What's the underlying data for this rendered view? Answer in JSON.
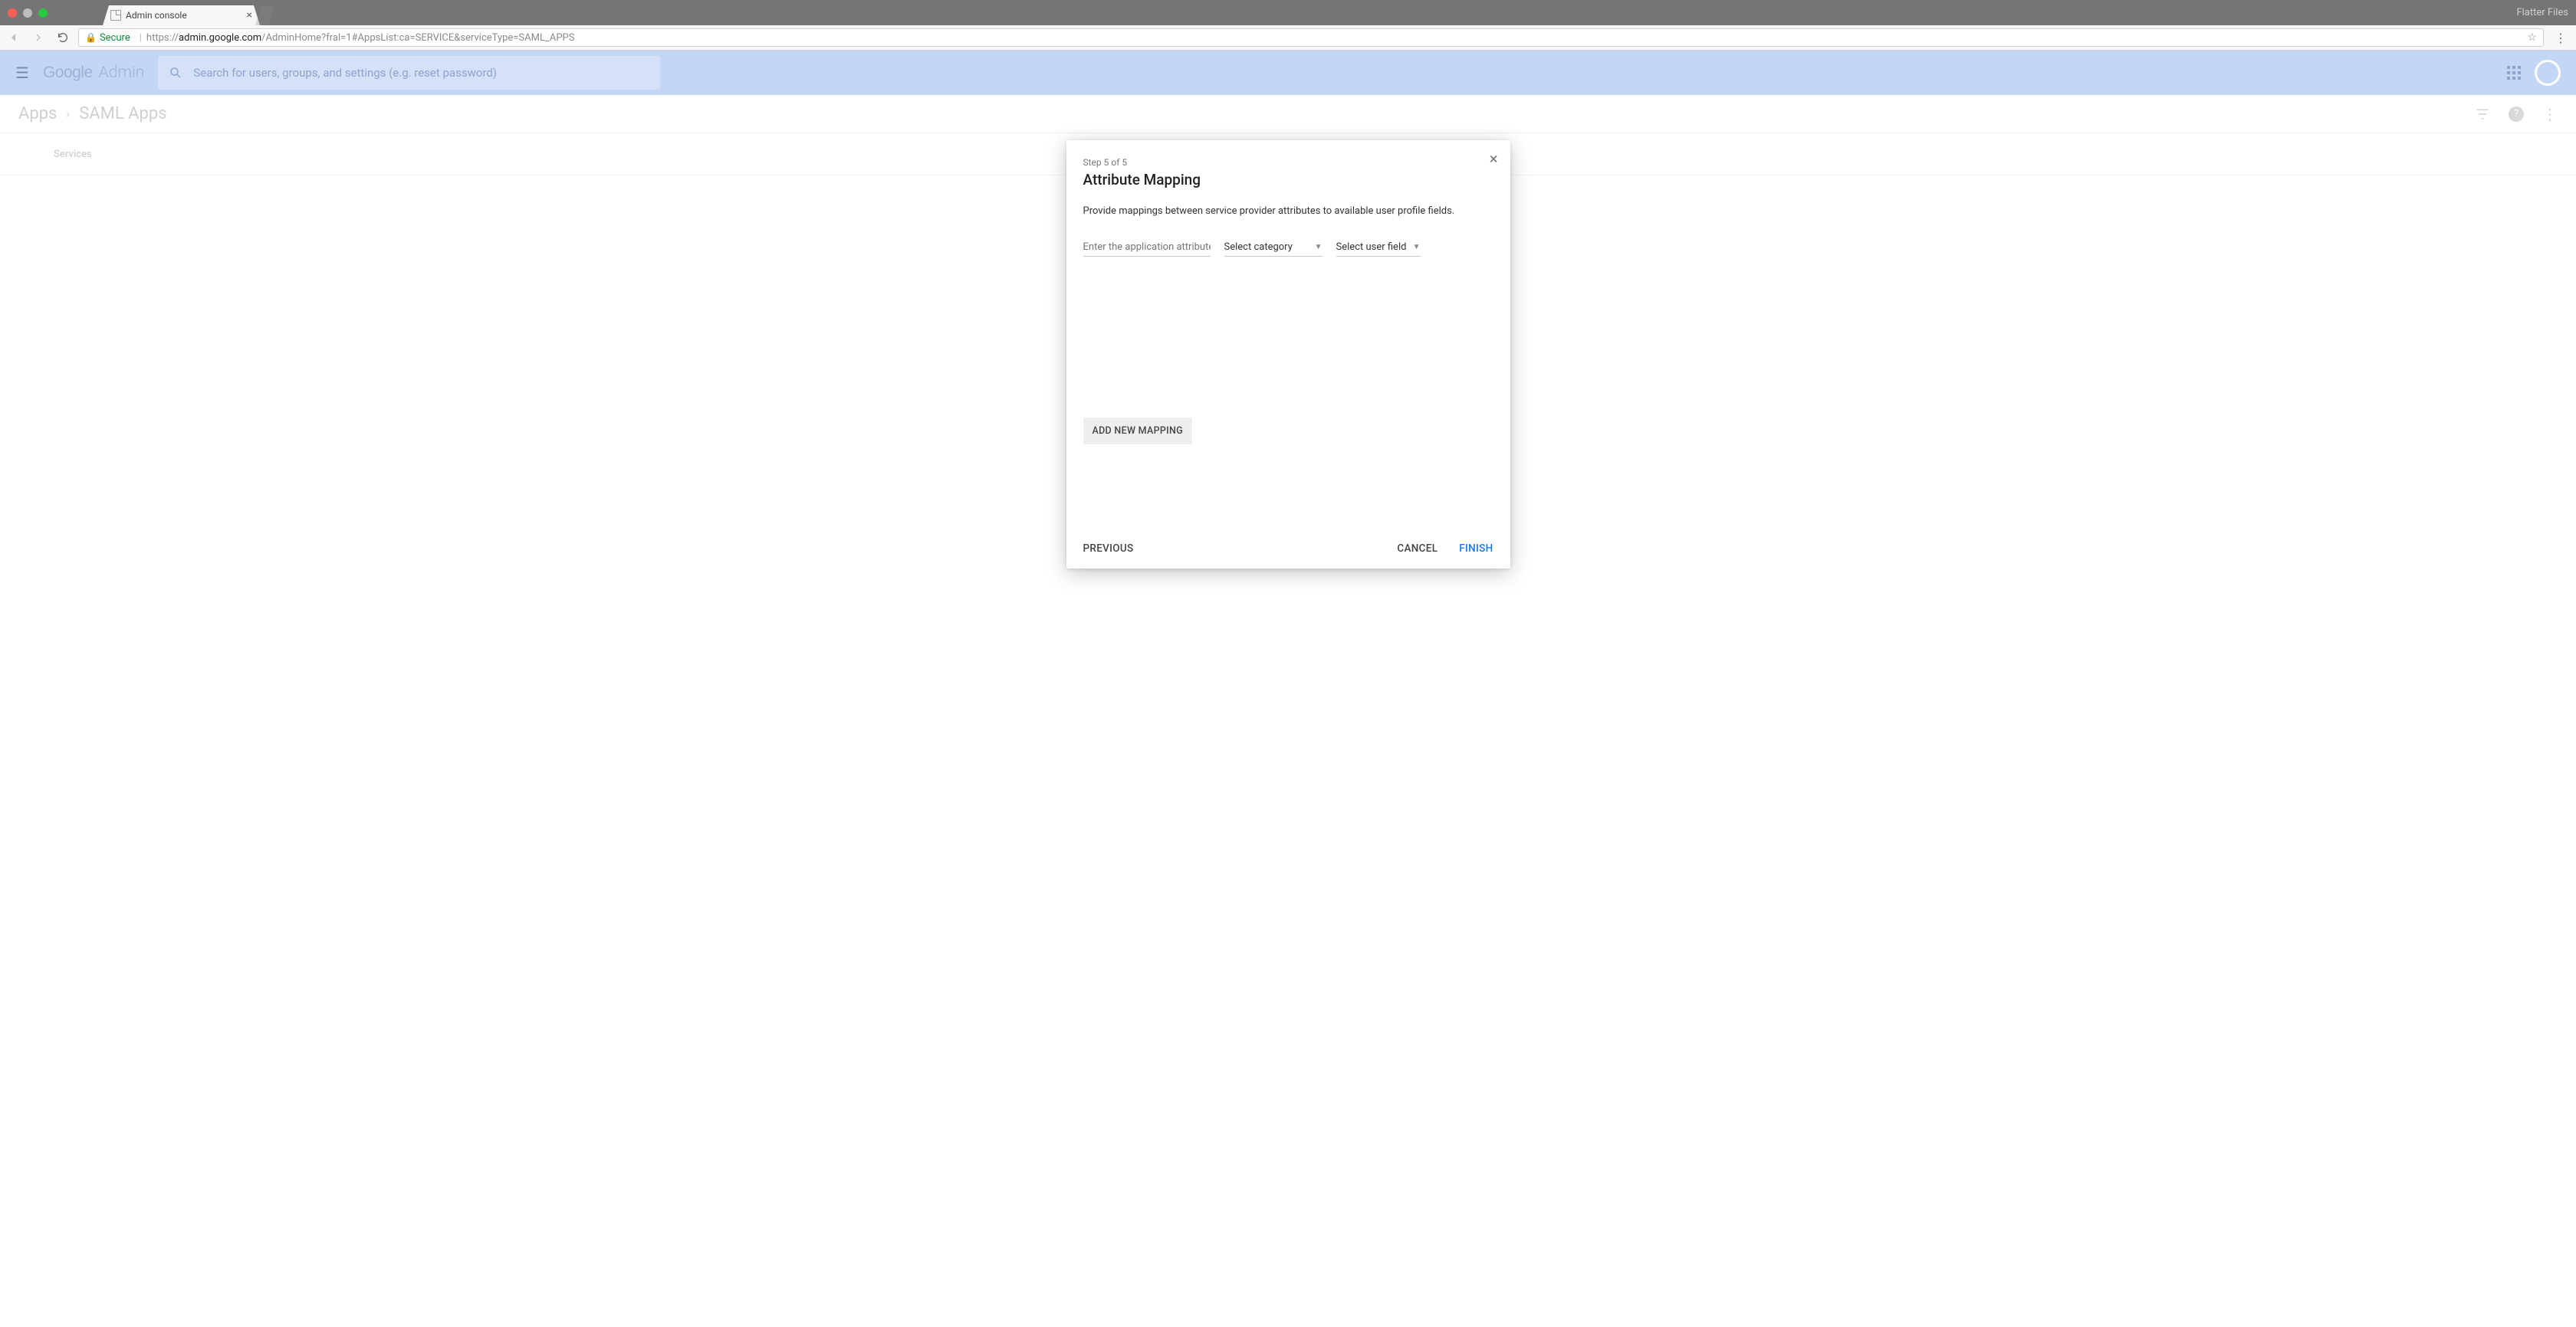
{
  "window": {
    "right_label": "Flatter Files"
  },
  "tab": {
    "title": "Admin console"
  },
  "omnibox": {
    "secure_label": "Secure",
    "proto": "https://",
    "host": "admin.google.com",
    "path": "/AdminHome?fral=1#AppsList:ca=SERVICE&serviceType=SAML_APPS"
  },
  "header": {
    "brand_google": "Google",
    "brand_admin": "Admin",
    "search_placeholder": "Search for users, groups, and settings (e.g. reset password)"
  },
  "breadcrumb": {
    "item1": "Apps",
    "item2": "SAML Apps"
  },
  "services_label": "Services",
  "modal": {
    "step": "Step 5 of 5",
    "title": "Attribute Mapping",
    "desc": "Provide mappings between service provider attributes to available user profile fields.",
    "attr_placeholder": "Enter the application attribute",
    "category_label": "Select category",
    "userfield_label": "Select user field",
    "add_mapping": "ADD NEW MAPPING",
    "previous": "PREVIOUS",
    "cancel": "CANCEL",
    "finish": "FINISH"
  }
}
